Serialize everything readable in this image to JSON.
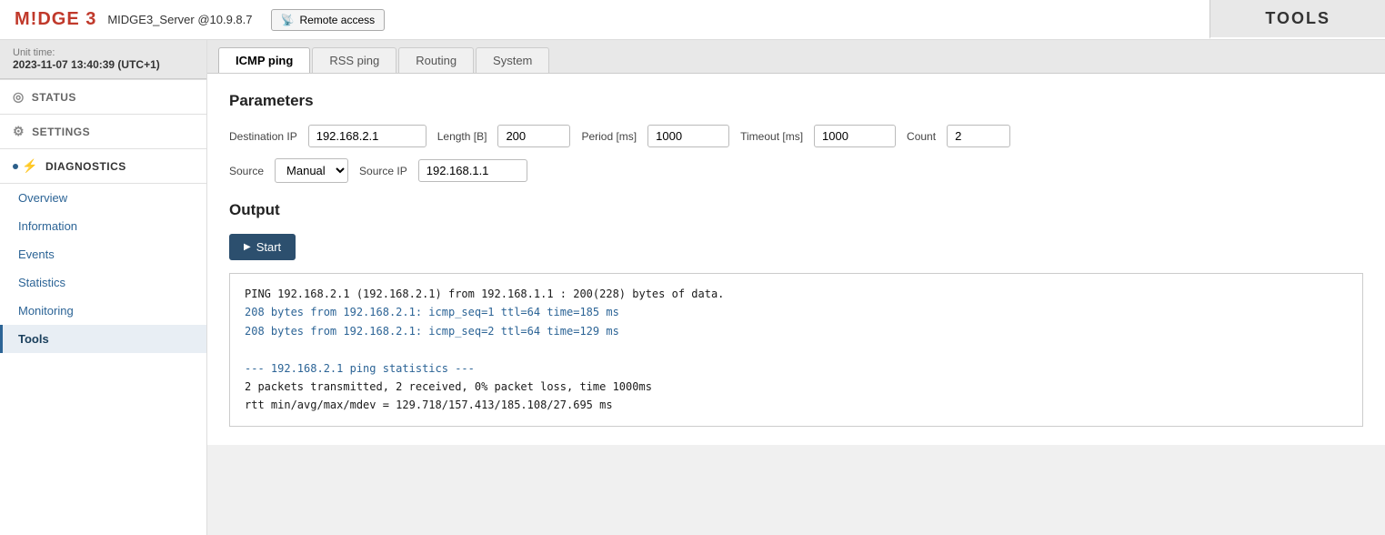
{
  "header": {
    "logo": "M!DGE 3",
    "server_name": "MIDGE3_Server @10.9.8.7",
    "remote_access_label": "Remote access",
    "tools_label": "TOOLS"
  },
  "sidebar": {
    "unit_time_label": "Unit time:",
    "unit_time_value": "2023-11-07 13:40:39 (UTC+1)",
    "sections": [
      {
        "id": "status",
        "label": "STATUS",
        "icon": "◎"
      },
      {
        "id": "settings",
        "label": "SETTINGS",
        "icon": "⚙"
      },
      {
        "id": "diagnostics",
        "label": "DIAGNOSTICS",
        "icon": "⚡",
        "active": true
      }
    ],
    "nav_items": [
      {
        "id": "overview",
        "label": "Overview"
      },
      {
        "id": "information",
        "label": "Information"
      },
      {
        "id": "events",
        "label": "Events"
      },
      {
        "id": "statistics",
        "label": "Statistics"
      },
      {
        "id": "monitoring",
        "label": "Monitoring"
      },
      {
        "id": "tools",
        "label": "Tools",
        "active": true
      }
    ]
  },
  "tabs": [
    {
      "id": "icmp-ping",
      "label": "ICMP ping",
      "active": true
    },
    {
      "id": "rss-ping",
      "label": "RSS ping"
    },
    {
      "id": "routing",
      "label": "Routing"
    },
    {
      "id": "system",
      "label": "System"
    }
  ],
  "parameters": {
    "title": "Parameters",
    "destination_ip_label": "Destination IP",
    "destination_ip_value": "192.168.2.1",
    "length_label": "Length [B]",
    "length_value": "200",
    "period_label": "Period [ms]",
    "period_value": "1000",
    "timeout_label": "Timeout [ms]",
    "timeout_value": "1000",
    "count_label": "Count",
    "count_value": "2",
    "source_label": "Source",
    "source_value": "Manual",
    "source_ip_label": "Source IP",
    "source_ip_value": "192.168.1.1"
  },
  "output": {
    "title": "Output",
    "start_label": "Start",
    "lines": [
      "PING 192.168.2.1 (192.168.2.1) from 192.168.1.1 : 200(228) bytes of data.",
      "208 bytes from 192.168.2.1: icmp_seq=1 ttl=64 time=185 ms",
      "208 bytes from 192.168.2.1: icmp_seq=2 ttl=64 time=129 ms",
      "",
      "--- 192.168.2.1 ping statistics ---",
      "2 packets transmitted, 2 received, 0% packet loss, time 1000ms",
      "rtt min/avg/max/mdev = 129.718/157.413/185.108/27.695 ms"
    ]
  }
}
